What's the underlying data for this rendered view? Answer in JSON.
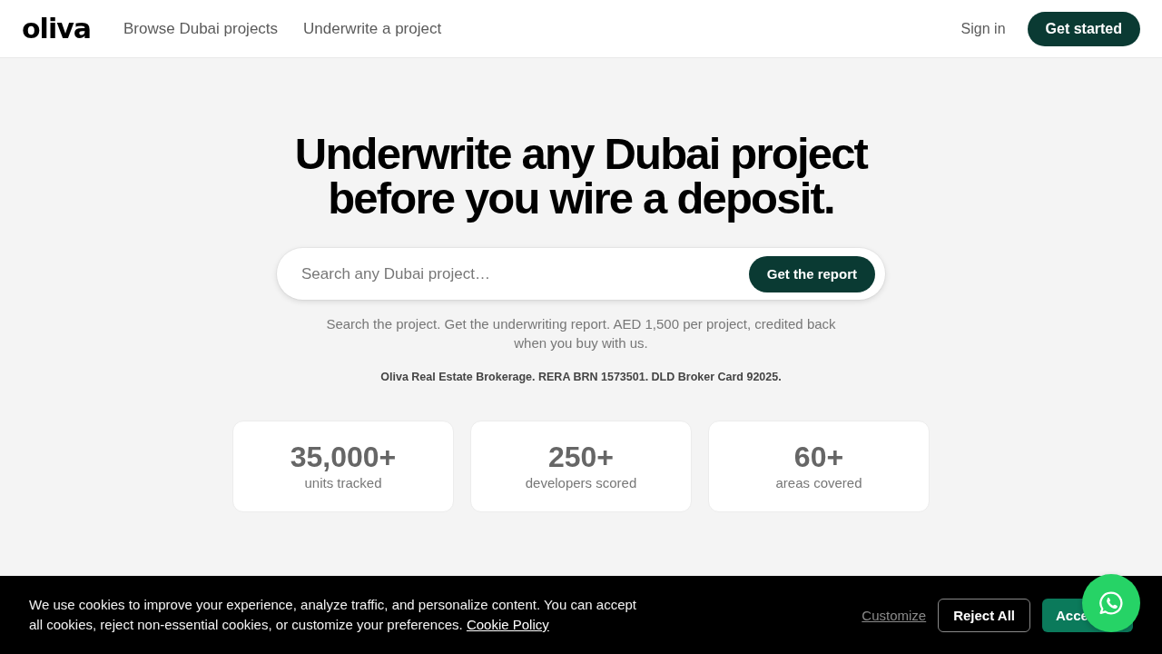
{
  "header": {
    "logo": "oliva",
    "nav_links": [
      "Browse Dubai projects",
      "Underwrite a project"
    ],
    "sign_in": "Sign in",
    "cta": "Get started"
  },
  "hero": {
    "title_lines": [
      "Underwrite any Dubai project",
      "before you wire a deposit."
    ],
    "search": {
      "placeholder": "Search any Dubai project…",
      "button": "Get the report"
    },
    "description": "Search the project. Get the underwriting report. AED 1,500 per project, credited back when you buy with us.",
    "license_note": "Oliva Real Estate Brokerage. RERA BRN 1573501. DLD Broker Card 92025."
  },
  "stats": [
    {
      "value": "35,000+",
      "label": "units tracked"
    },
    {
      "value": "250+",
      "label": "developers scored"
    },
    {
      "value": "60+",
      "label": "areas covered"
    }
  ],
  "cookie_banner": {
    "message": "We use cookies to improve your experience, analyze traffic, and personalize content. You can accept all cookies, reject non-essential cookies, or customize your preferences.",
    "policy_link": "Cookie Policy",
    "buttons": [
      {
        "kind": "link",
        "label": "Customize"
      },
      {
        "kind": "outline",
        "label": "Reject All"
      },
      {
        "kind": "primary",
        "label": "Acce"
      }
    ]
  }
}
